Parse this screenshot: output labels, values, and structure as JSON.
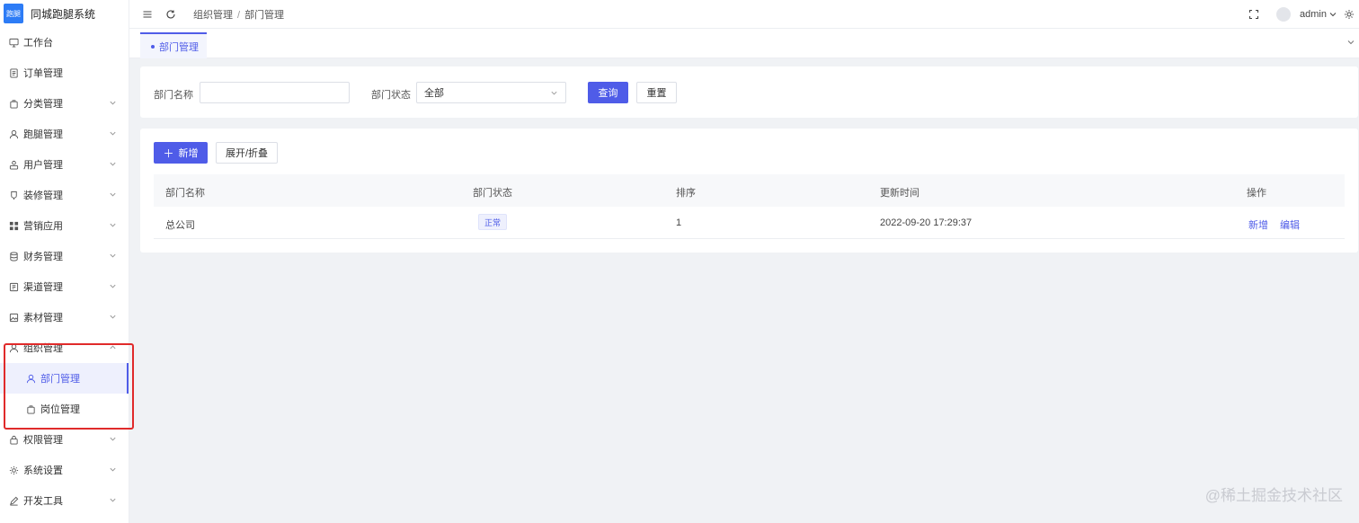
{
  "app": {
    "logo_text": "跑腿",
    "title": "同城跑腿系统"
  },
  "sidebar": {
    "items": [
      {
        "label": "工作台",
        "icon": "monitor-icon",
        "expandable": false
      },
      {
        "label": "订单管理",
        "icon": "document-icon",
        "expandable": false
      },
      {
        "label": "分类管理",
        "icon": "bag-icon",
        "expandable": true
      },
      {
        "label": "跑腿管理",
        "icon": "user-icon",
        "expandable": true
      },
      {
        "label": "用户管理",
        "icon": "users-icon",
        "expandable": true
      },
      {
        "label": "装修管理",
        "icon": "brush-icon",
        "expandable": true
      },
      {
        "label": "营销应用",
        "icon": "grid-icon",
        "expandable": true
      },
      {
        "label": "财务管理",
        "icon": "database-icon",
        "expandable": true
      },
      {
        "label": "渠道管理",
        "icon": "channel-icon",
        "expandable": true
      },
      {
        "label": "素材管理",
        "icon": "image-icon",
        "expandable": true
      },
      {
        "label": "组织管理",
        "icon": "user-icon",
        "expandable": true,
        "expanded": true,
        "children": [
          {
            "label": "部门管理",
            "icon": "user-icon",
            "active": true
          },
          {
            "label": "岗位管理",
            "icon": "bag-icon",
            "active": false
          }
        ]
      },
      {
        "label": "权限管理",
        "icon": "lock-icon",
        "expandable": true
      },
      {
        "label": "系统设置",
        "icon": "gear-icon",
        "expandable": true
      },
      {
        "label": "开发工具",
        "icon": "pen-icon",
        "expandable": true
      }
    ]
  },
  "topbar": {
    "breadcrumb": [
      "组织管理",
      "部门管理"
    ],
    "user": "admin"
  },
  "tabs": [
    {
      "label": "部门管理",
      "active": true
    }
  ],
  "search": {
    "name_label": "部门名称",
    "name_value": "",
    "status_label": "部门状态",
    "status_value": "全部",
    "query_button": "查询",
    "reset_button": "重置"
  },
  "toolbar": {
    "add_button": "新增",
    "toggle_button": "展开/折叠"
  },
  "table": {
    "columns": [
      "部门名称",
      "部门状态",
      "排序",
      "更新时间",
      "操作"
    ],
    "rows": [
      {
        "name": "总公司",
        "status": "正常",
        "sort": "1",
        "updated": "2022-09-20 17:29:37",
        "actions": [
          "新增",
          "编辑"
        ]
      }
    ]
  },
  "watermark": "@稀土掘金技术社区",
  "colors": {
    "primary": "#4f5ce8",
    "logo": "#2d7cf6",
    "highlight": "#e02a2a"
  }
}
